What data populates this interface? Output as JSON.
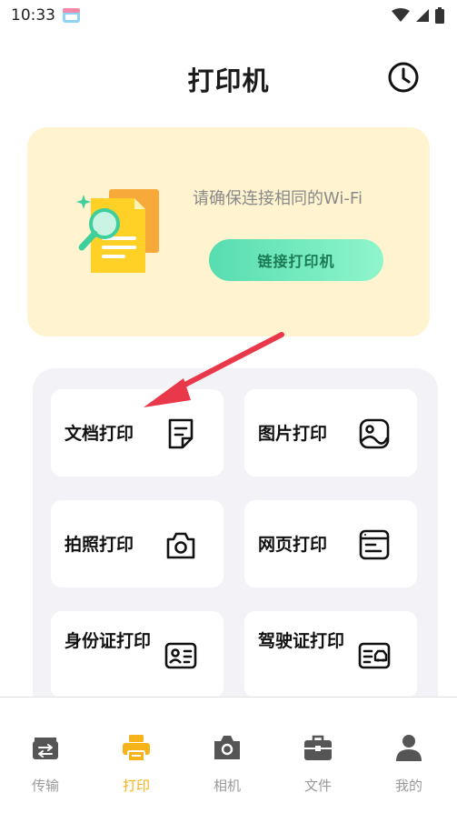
{
  "status": {
    "time": "10:33"
  },
  "header": {
    "title": "打印机"
  },
  "connect_card": {
    "hint": "请确保连接相同的Wi-Fi",
    "button_label": "链接打印机"
  },
  "tiles": [
    {
      "label": "文档打印",
      "icon": "document-icon"
    },
    {
      "label": "图片打印",
      "icon": "image-icon"
    },
    {
      "label": "拍照打印",
      "icon": "camera-icon"
    },
    {
      "label": "网页打印",
      "icon": "webpage-icon"
    },
    {
      "label": "身份证打印",
      "icon": "id-card-icon"
    },
    {
      "label": "驾驶证打印",
      "icon": "driver-license-icon"
    }
  ],
  "nav": {
    "items": [
      {
        "label": "传输",
        "icon": "transfer-icon"
      },
      {
        "label": "打印",
        "icon": "printer-icon"
      },
      {
        "label": "相机",
        "icon": "camera-icon"
      },
      {
        "label": "文件",
        "icon": "briefcase-icon"
      },
      {
        "label": "我的",
        "icon": "profile-icon"
      }
    ],
    "active_index": 1
  },
  "colors": {
    "accent": "#f6b41a",
    "card_bg": "#fff4cf",
    "button_green": "#57ddb0",
    "arrow_red": "#e8384a",
    "panel_bg": "#f3f3f7"
  }
}
